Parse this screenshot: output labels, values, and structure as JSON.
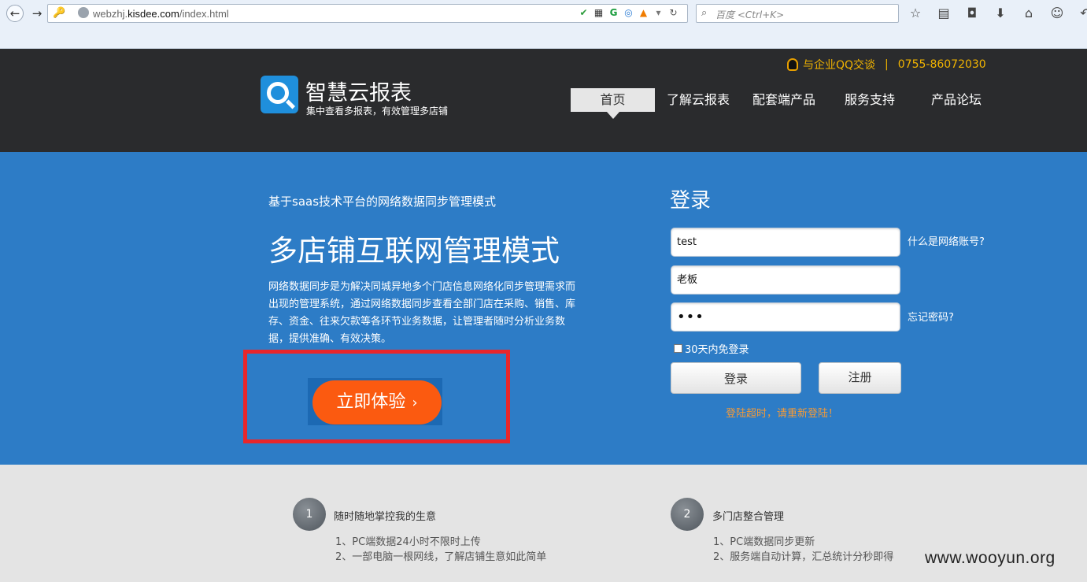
{
  "browser": {
    "url_prefix": "webzhj.",
    "url_domain": "kisdee.com",
    "url_path": "/index.html",
    "search_placeholder": "百度 <Ctrl+K>"
  },
  "header": {
    "contact_qq": "与企业QQ交谈",
    "contact_sep": "|",
    "contact_phone": "0755-86072030",
    "logo_title": "智慧云报表",
    "logo_subtitle": "集中查看多报表，有效管理多店铺",
    "nav": [
      {
        "label": "首页"
      },
      {
        "label": "了解云报表"
      },
      {
        "label": "配套端产品"
      },
      {
        "label": "服务支持"
      },
      {
        "label": "产品论坛"
      }
    ]
  },
  "banner": {
    "tagline": "基于saas技术平台的网络数据同步管理模式",
    "headline": "多店铺互联网管理模式",
    "description": "网络数据同步是为解决同城异地多个门店信息网络化同步管理需求而出现的管理系统，通过网络数据同步查看全部门店在采购、销售、库存、资金、往来欠款等各环节业务数据，让管理者随时分析业务数据，提供准确、有效决策。",
    "cta_label": "立即体验",
    "cta_chevron": "›"
  },
  "login": {
    "title": "登录",
    "username_value": "test",
    "role_value": "老板",
    "password_mask": "•••",
    "what_is_account": "什么是网络账号?",
    "forgot_password": "忘记密码?",
    "remember_label": "30天内免登录",
    "login_button": "登录",
    "register_button": "注册",
    "error_message": "登陆超时，请重新登陆！"
  },
  "features": [
    {
      "number": "1",
      "title": "随时随地掌控我的生意",
      "lines": [
        "1、PC端数据24小时不限时上传",
        "2、一部电脑一根网线，了解店铺生意如此简单"
      ]
    },
    {
      "number": "2",
      "title": "多门店整合管理",
      "lines": [
        "1、PC端数据同步更新",
        "2、服务端自动计算，汇总统计分秒即得"
      ]
    }
  ],
  "watermark": "www.wooyun.org"
}
